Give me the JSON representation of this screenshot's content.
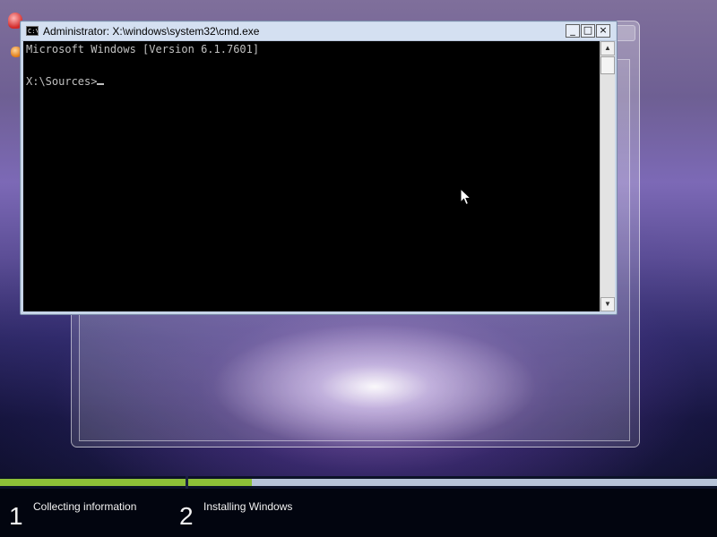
{
  "cmd_window": {
    "title": "Administrator: X:\\windows\\system32\\cmd.exe",
    "icon_label": "C:\\",
    "controls": {
      "minimize": "_",
      "maximize": "□",
      "close": "×"
    },
    "console_lines": [
      "Microsoft Windows [Version 6.1.7601]",
      "",
      "X:\\Sources>"
    ],
    "scroll_up_symbol": "▲",
    "scroll_down_symbol": "▼"
  },
  "installer": {
    "steps": [
      {
        "number": "1",
        "label": "Collecting information",
        "progress": 1.0
      },
      {
        "number": "2",
        "label": "Installing Windows",
        "progress": 0.12
      }
    ]
  },
  "colors": {
    "progress_fill": "#8dc038",
    "progress_track": "#b7c4d8",
    "console_bg": "#000000",
    "console_text": "#c0c0c0"
  },
  "icons": {
    "cmd_app": "console-icon",
    "pointer": "mouse-pointer-icon"
  }
}
